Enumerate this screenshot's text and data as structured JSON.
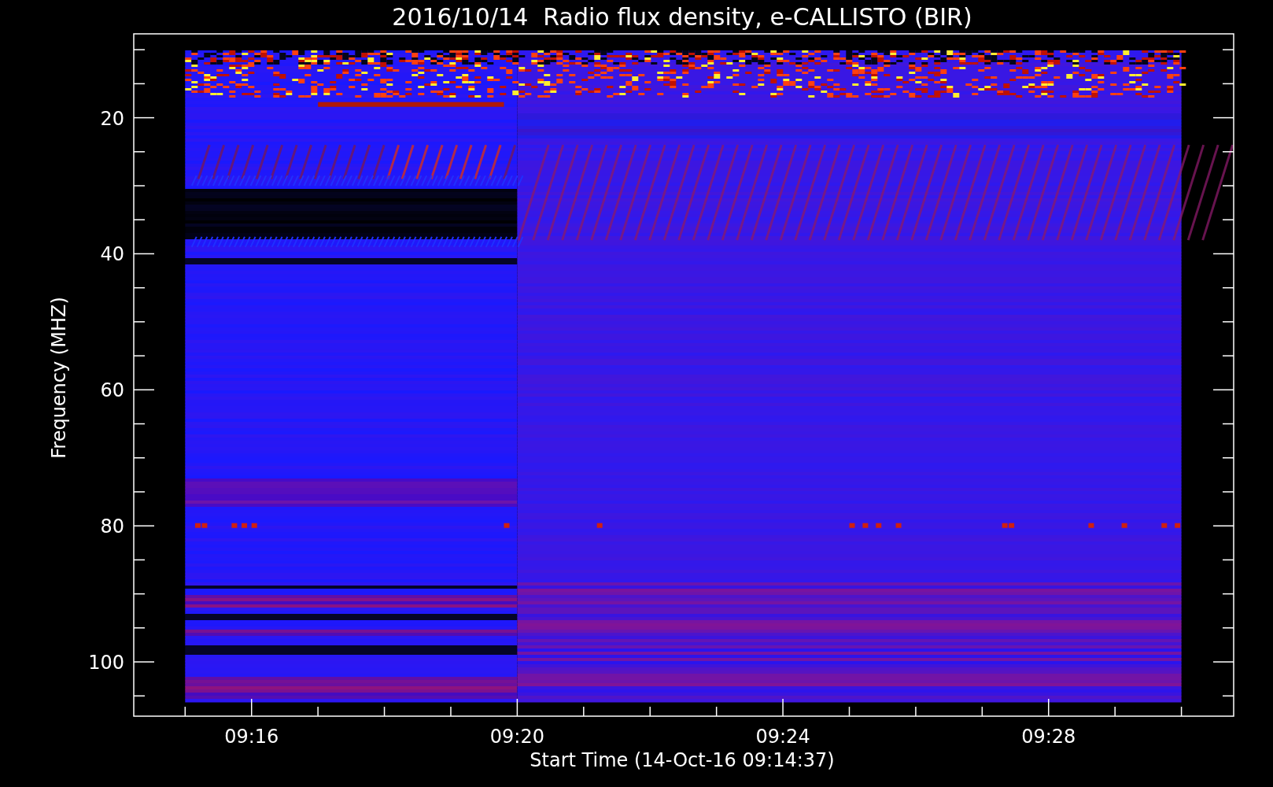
{
  "plot": {
    "title": "2016/10/14  Radio flux density, e-CALLISTO (BIR)",
    "y_axis": {
      "label": "Frequency (MHZ)",
      "tick_labels": [
        "20",
        "40",
        "60",
        "80",
        "100"
      ]
    },
    "x_axis": {
      "label": "Start Time (14-Oct-16 09:14:37)",
      "tick_labels": [
        "09:16",
        "09:20",
        "09:24",
        "09:28"
      ]
    }
  }
}
